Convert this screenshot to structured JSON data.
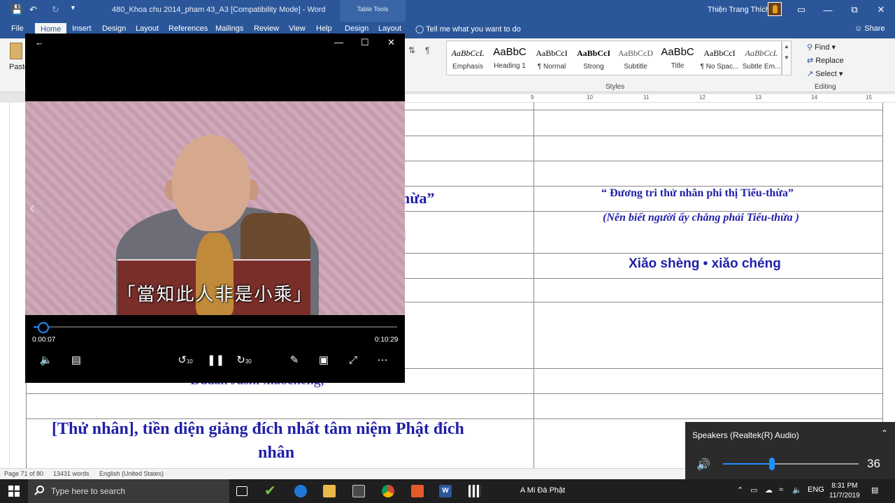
{
  "word": {
    "doc_title": "480_Khoa chu 2014_pham 43_A3 [Compatibility Mode]  -  Word",
    "table_tools": "Table Tools",
    "user_name": "Thiện Trang Thích",
    "tabs": [
      "File",
      "Home",
      "Insert",
      "Design",
      "Layout",
      "References",
      "Mailings",
      "Review",
      "View",
      "Help",
      "Design",
      "Layout"
    ],
    "tell_me": "Tell me what you want to do",
    "share": "Share",
    "paste": "Paste",
    "styles": [
      {
        "sample": "AaBbCcL",
        "name": "Emphasis"
      },
      {
        "sample": "AaBbC",
        "name": "Heading 1"
      },
      {
        "sample": "AaBbCcI",
        "name": "¶ Normal"
      },
      {
        "sample": "AaBbCcI",
        "name": "Strong"
      },
      {
        "sample": "AaBbCcD",
        "name": "Subtitle"
      },
      {
        "sample": "AaBbC",
        "name": "Title"
      },
      {
        "sample": "AaBbCcI",
        "name": "¶ No Spac..."
      },
      {
        "sample": "AaBbCcL",
        "name": "Subtle Em..."
      }
    ],
    "styles_label": "Styles",
    "editing": {
      "find": "Find",
      "replace": "Replace",
      "select": "Select",
      "label": "Editing"
    },
    "ruler_numbers": [
      "9",
      "10",
      "11",
      "12",
      "13",
      "14",
      "15"
    ],
    "doc_text": {
      "left_partial": "hừa”",
      "bracket": "]",
      "right_1": "“ Đương tri thử nhân phi thị Tiểu-thừa”",
      "right_2": "(Nên biết người ấy chẳng phải Tiểu-thừa )",
      "right_3": "Xiǎo shèng • xiǎo chéng",
      "left_pinyin": "Dudan Jushi xiaocheng,",
      "left_main": "[Thử nhân], tiền diện giảng đích nhất tâm niệm Phật đích",
      "left_main_2": "nhân"
    },
    "status": {
      "page": "Page 71 of 80",
      "words": "13431 words",
      "language": "English (United States)"
    }
  },
  "player": {
    "subtitle": "「當知此人非是小乘」",
    "current_time": "0:00:07",
    "total_time": "0:10:29",
    "progress_fraction": 0.011,
    "skip_back": "10",
    "skip_forward": "30"
  },
  "volume": {
    "device": "Speakers (Realtek(R) Audio)",
    "level": "36"
  },
  "taskbar": {
    "search_placeholder": "Type here to search",
    "running_label": "A Mi Đà Phật",
    "language": "ENG",
    "time": "8:31 PM",
    "date": "11/7/2019"
  }
}
